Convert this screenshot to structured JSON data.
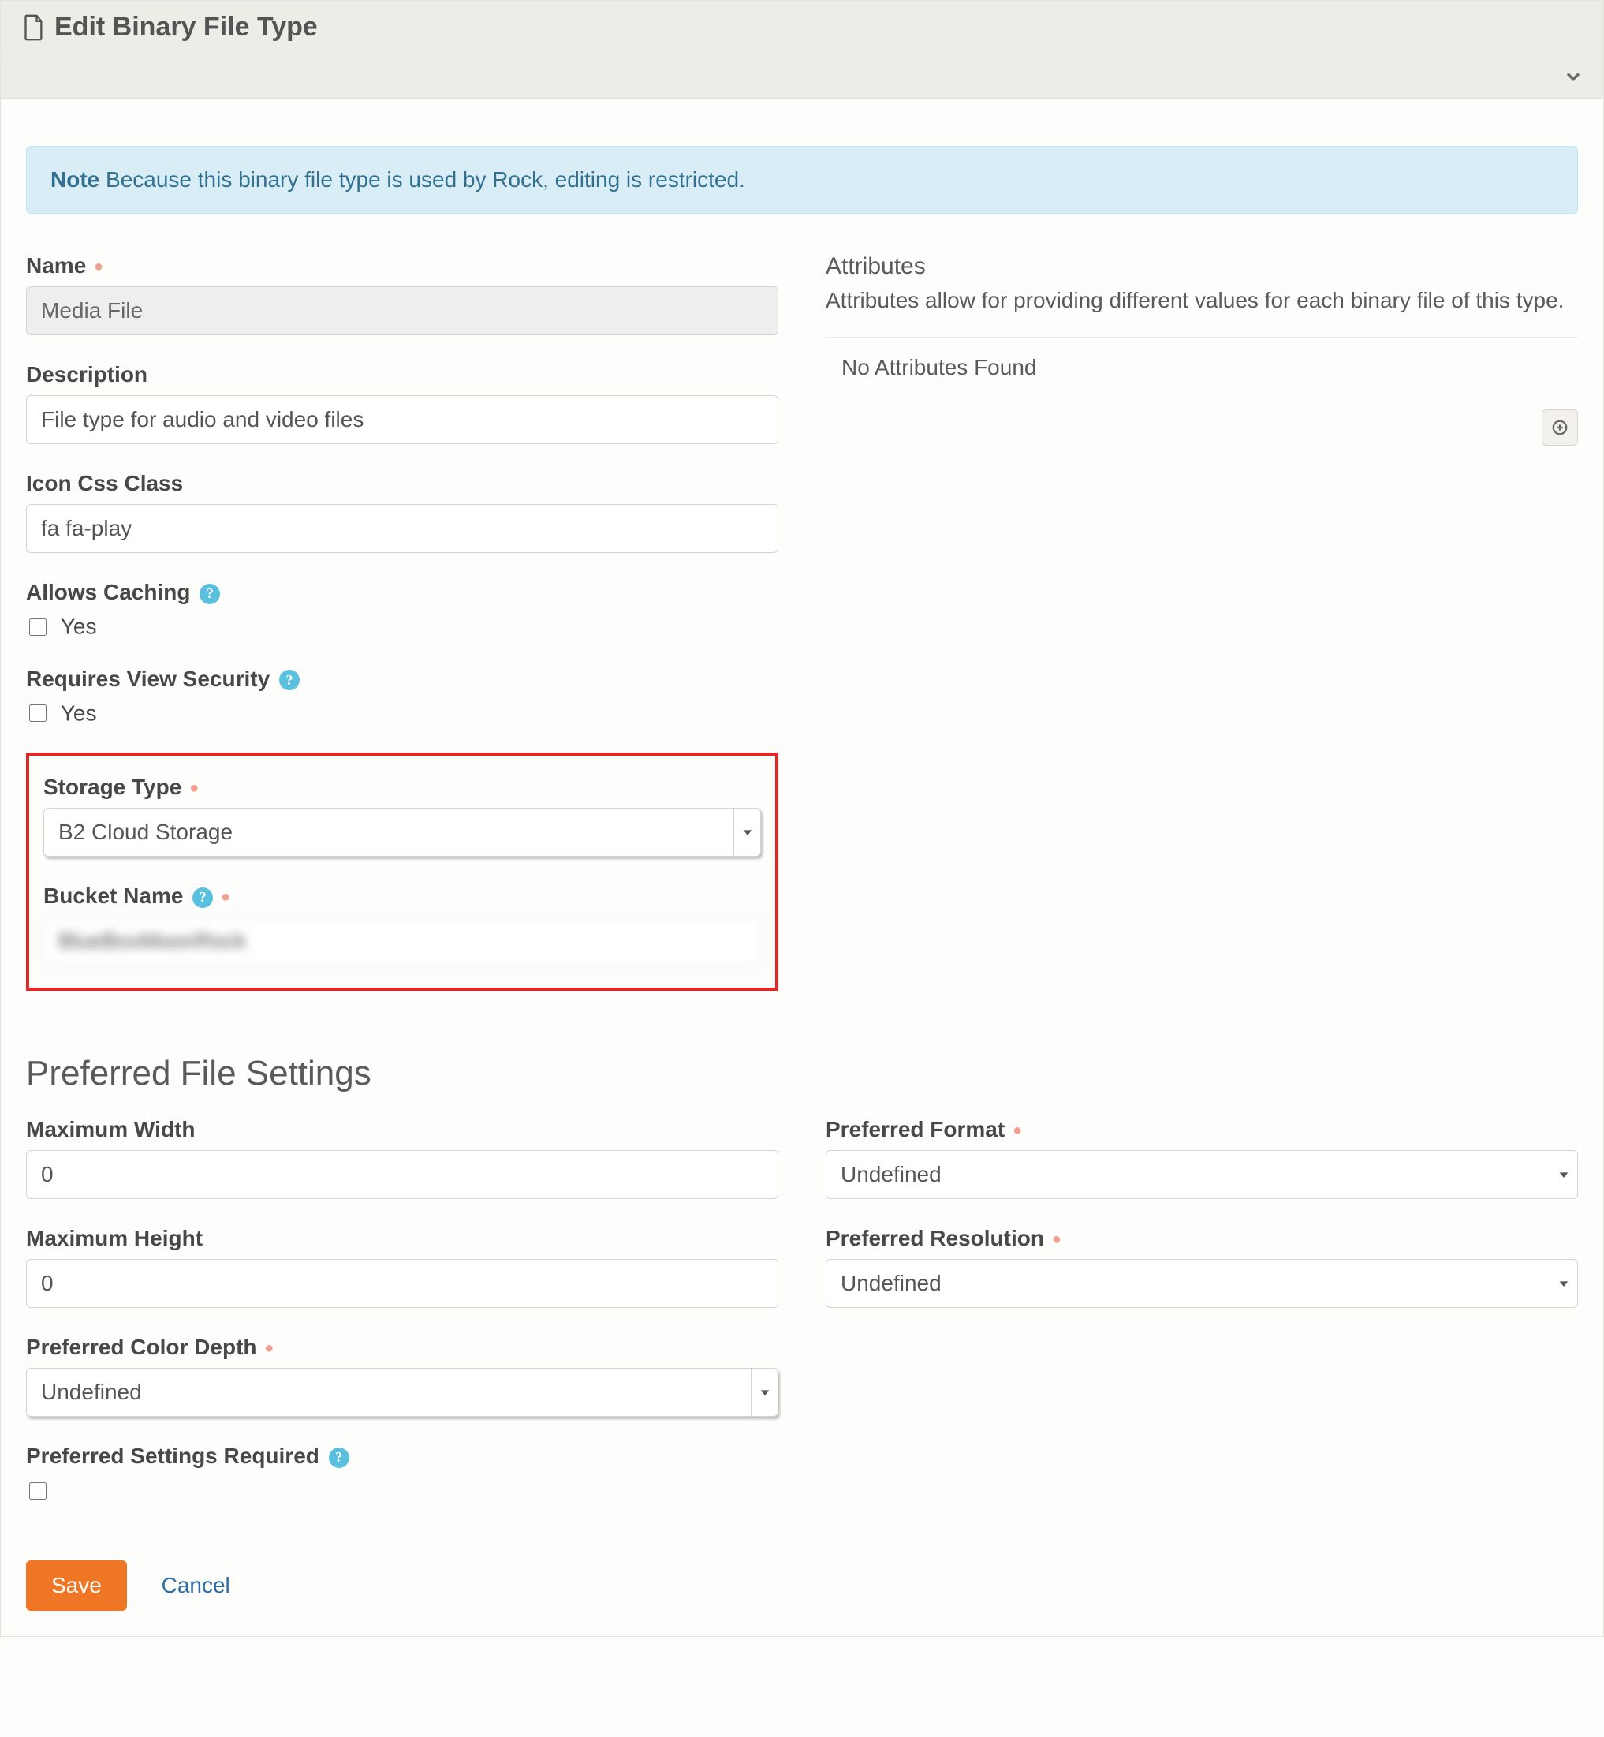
{
  "header": {
    "title": "Edit Binary File Type"
  },
  "note": {
    "label": "Note",
    "text": "Because this binary file type is used by Rock, editing is restricted."
  },
  "form": {
    "name_label": "Name",
    "name_value": "Media File",
    "description_label": "Description",
    "description_value": "File type for audio and video files",
    "icon_label": "Icon Css Class",
    "icon_value": "fa fa-play",
    "allows_caching_label": "Allows Caching",
    "allows_caching_option": "Yes",
    "requires_view_security_label": "Requires View Security",
    "requires_view_security_option": "Yes",
    "storage_type_label": "Storage Type",
    "storage_type_value": "B2 Cloud Storage",
    "bucket_name_label": "Bucket Name",
    "bucket_name_value": "BlueBoxMoonRock"
  },
  "attributes": {
    "title": "Attributes",
    "description": "Attributes allow for providing different values for each binary file of this type.",
    "empty": "No Attributes Found"
  },
  "preferred": {
    "section_title": "Preferred File Settings",
    "max_width_label": "Maximum Width",
    "max_width_value": "0",
    "max_height_label": "Maximum Height",
    "max_height_value": "0",
    "color_depth_label": "Preferred Color Depth",
    "color_depth_value": "Undefined",
    "settings_required_label": "Preferred Settings Required",
    "format_label": "Preferred Format",
    "format_value": "Undefined",
    "resolution_label": "Preferred Resolution",
    "resolution_value": "Undefined"
  },
  "actions": {
    "save": "Save",
    "cancel": "Cancel"
  }
}
